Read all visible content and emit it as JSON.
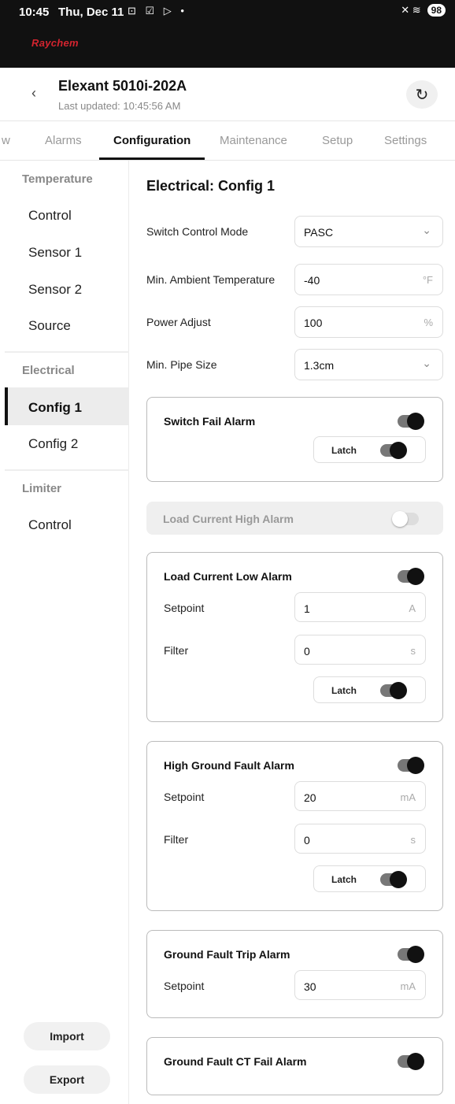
{
  "status_bar": {
    "time": "10:45",
    "date": "Thu, Dec 11",
    "icons": "⊡ ☑ ▷ •",
    "right_icons": "✕ ≋",
    "battery": "98"
  },
  "brand": {
    "name": "Raychem",
    "color": "#d3242f"
  },
  "header": {
    "title": "Elexant 5010i-202A",
    "last_updated": "Last updated: 10:45:56 AM",
    "back_icon": "chevron-left-icon",
    "refresh_icon": "refresh-icon"
  },
  "tabs": [
    {
      "label": "w"
    },
    {
      "label": "Alarms"
    },
    {
      "label": "Configuration",
      "active": true
    },
    {
      "label": "Maintenance"
    },
    {
      "label": "Setup"
    },
    {
      "label": "Settings"
    }
  ],
  "sidebar": {
    "groups": [
      {
        "label": "Temperature",
        "items": [
          "Control",
          "Sensor 1",
          "Sensor 2",
          "Source"
        ]
      },
      {
        "label": "Electrical",
        "items": [
          "Config 1",
          "Config 2"
        ]
      },
      {
        "label": "Limiter",
        "items": [
          "Control"
        ]
      }
    ],
    "active_item": "Config 1",
    "import_label": "Import",
    "export_label": "Export"
  },
  "main": {
    "title": "Electrical: Config 1",
    "fields": [
      {
        "label": "Switch Control Mode",
        "value": "PASC",
        "type": "select"
      },
      {
        "label": "Min. Ambient Temperature",
        "value": "-40",
        "unit": "°F"
      },
      {
        "label": "Power Adjust",
        "value": "100",
        "unit": "%"
      },
      {
        "label": "Min. Pipe Size",
        "value": "1.3cm",
        "type": "select"
      }
    ],
    "alarms": [
      {
        "title": "Switch Fail Alarm",
        "enabled": true,
        "latch_label": "Latch",
        "latch": true
      },
      {
        "title": "Load Current High Alarm",
        "enabled": false,
        "disabled": true
      },
      {
        "title": "Load Current Low Alarm",
        "enabled": true,
        "setpoint_label": "Setpoint",
        "setpoint": "1",
        "setpoint_unit": "A",
        "filter_label": "Filter",
        "filter": "0",
        "filter_unit": "s",
        "latch_label": "Latch",
        "latch": true
      },
      {
        "title": "High Ground Fault Alarm",
        "enabled": true,
        "setpoint_label": "Setpoint",
        "setpoint": "20",
        "setpoint_unit": "mA",
        "filter_label": "Filter",
        "filter": "0",
        "filter_unit": "s",
        "latch_label": "Latch",
        "latch": true
      },
      {
        "title": "Ground Fault Trip Alarm",
        "enabled": true,
        "setpoint_label": "Setpoint",
        "setpoint": "30",
        "setpoint_unit": "mA"
      },
      {
        "title": "Ground Fault CT Fail Alarm",
        "enabled": true
      }
    ]
  }
}
